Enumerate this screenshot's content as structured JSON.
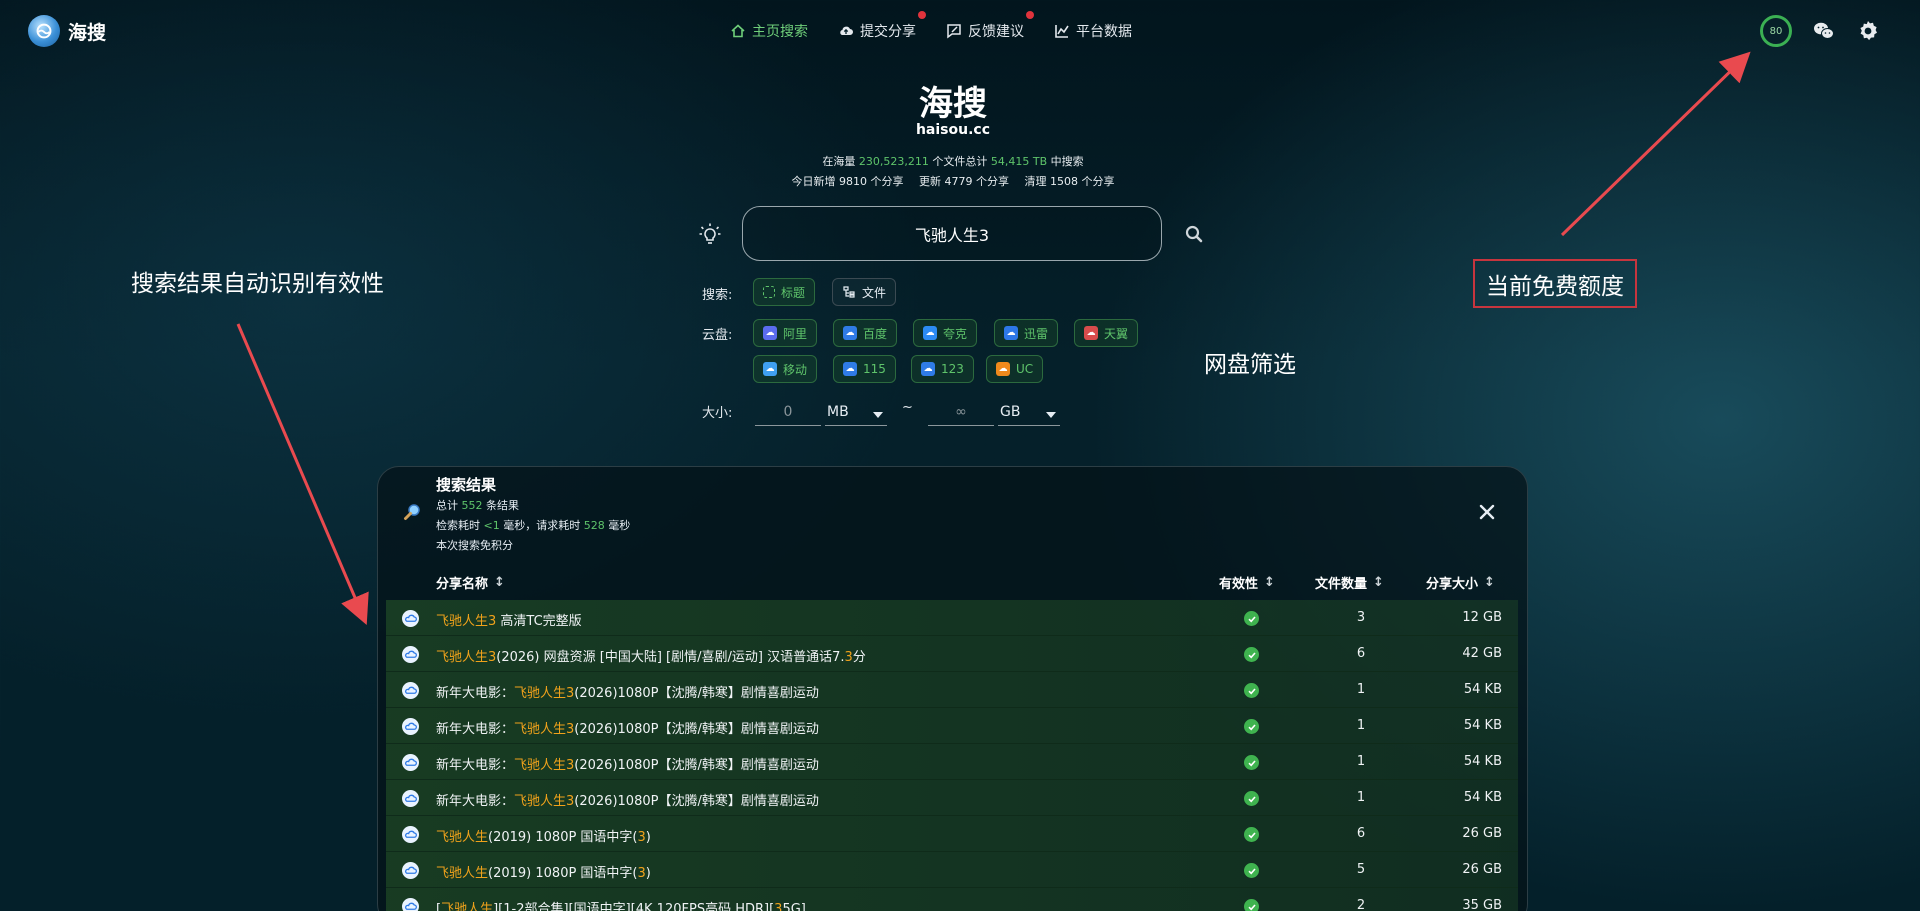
{
  "brand": {
    "name": "海搜"
  },
  "nav": [
    {
      "label": "主页搜索",
      "icon": "home-icon",
      "active": true,
      "dot": false
    },
    {
      "label": "提交分享",
      "icon": "cloud-upload-icon",
      "active": false,
      "dot": true
    },
    {
      "label": "反馈建议",
      "icon": "feedback-icon",
      "active": false,
      "dot": true
    },
    {
      "label": "平台数据",
      "icon": "chart-icon",
      "active": false,
      "dot": false
    }
  ],
  "quota": {
    "value": "80"
  },
  "hero": {
    "title": "海搜",
    "domain": "haisou.cc",
    "stats": {
      "prefix": "在海量",
      "files": "230,523,211",
      "mid": "个文件总计",
      "size": "54,415 TB",
      "suffix": "中搜索"
    },
    "daily": {
      "new": "今日新增 9810 个分享",
      "updated": "更新 4779 个分享",
      "cleaned": "清理 1508 个分享"
    }
  },
  "search": {
    "query": "飞驰人生3"
  },
  "filters": {
    "search_label": "搜索:",
    "search_modes": [
      {
        "label": "标题",
        "icon": "title-scan-icon",
        "selected": true
      },
      {
        "label": "文件",
        "icon": "file-tree-icon",
        "selected": false
      }
    ],
    "cloud_label": "云盘:",
    "clouds": [
      {
        "label": "阿里",
        "color": "#5b6cf0"
      },
      {
        "label": "百度",
        "color": "#2f7be6"
      },
      {
        "label": "夸克",
        "color": "#2c8bf2"
      },
      {
        "label": "迅雷",
        "color": "#2d77e8"
      },
      {
        "label": "天翼",
        "color": "#d84c4c"
      },
      {
        "label": "移动",
        "color": "#3fa0f0"
      },
      {
        "label": "115",
        "color": "#2f7be6"
      },
      {
        "label": "123",
        "color": "#2f7be6"
      },
      {
        "label": "UC",
        "color": "#f08a1c"
      }
    ],
    "size_label": "大小:",
    "size_min": "0",
    "size_min_unit": "MB",
    "size_tilde": "~",
    "size_max": "∞",
    "size_max_unit": "GB"
  },
  "annotations": {
    "left": "搜索结果自动识别有效性",
    "middle": "网盘筛选",
    "right": "当前免费额度"
  },
  "results": {
    "title": "搜索结果",
    "total_prefix": "总计",
    "total": "552",
    "total_suffix": "条结果",
    "timing_a": "检索耗时",
    "timing_search": "<1",
    "timing_b": "毫秒，请求耗时",
    "timing_request": "528",
    "timing_c": "毫秒",
    "free_note": "本次搜索免积分",
    "columns": {
      "name": "分享名称",
      "valid": "有效性",
      "count": "文件数量",
      "size": "分享大小"
    },
    "rows": [
      {
        "pre": "",
        "hl": "飞驰人生3",
        "post": " 高清TC完整版",
        "post_hl": "",
        "post2": "",
        "count": "3",
        "size": "12 GB"
      },
      {
        "pre": "",
        "hl": "飞驰人生3",
        "post": "(2026) 网盘资源 [中国大陆] [剧情/喜剧/运动] 汉语普通话7.",
        "post_hl": "3",
        "post2": "分",
        "count": "6",
        "size": "42 GB"
      },
      {
        "pre": "新年大电影：",
        "hl": "飞驰人生3",
        "post": "(2026)1080P【沈腾/韩寒】剧情喜剧运动",
        "post_hl": "",
        "post2": "",
        "count": "1",
        "size": "54 KB"
      },
      {
        "pre": "新年大电影：",
        "hl": "飞驰人生3",
        "post": "(2026)1080P【沈腾/韩寒】剧情喜剧运动",
        "post_hl": "",
        "post2": "",
        "count": "1",
        "size": "54 KB"
      },
      {
        "pre": "新年大电影：",
        "hl": "飞驰人生3",
        "post": "(2026)1080P【沈腾/韩寒】剧情喜剧运动",
        "post_hl": "",
        "post2": "",
        "count": "1",
        "size": "54 KB"
      },
      {
        "pre": "新年大电影：",
        "hl": "飞驰人生3",
        "post": "(2026)1080P【沈腾/韩寒】剧情喜剧运动",
        "post_hl": "",
        "post2": "",
        "count": "1",
        "size": "54 KB"
      },
      {
        "pre": "",
        "hl": "飞驰人生",
        "post": "(2019) 1080P 国语中字(",
        "post_hl": "3",
        "post2": ")",
        "count": "6",
        "size": "26 GB"
      },
      {
        "pre": "",
        "hl": "飞驰人生",
        "post": "(2019) 1080P 国语中字(",
        "post_hl": "3",
        "post2": ")",
        "count": "5",
        "size": "26 GB"
      },
      {
        "pre": "[",
        "hl": "飞驰人生",
        "post": "][1-2部合集][国语中字][4K 120FPS高码 HDR][",
        "post_hl": "3",
        "post2": "5G]",
        "count": "2",
        "size": "35 GB"
      }
    ]
  },
  "colors": {
    "accent": "#5ec46a",
    "highlight": "#f0a21b",
    "annotation_box": "#c7353e",
    "badge_dot": "#e0333c"
  }
}
